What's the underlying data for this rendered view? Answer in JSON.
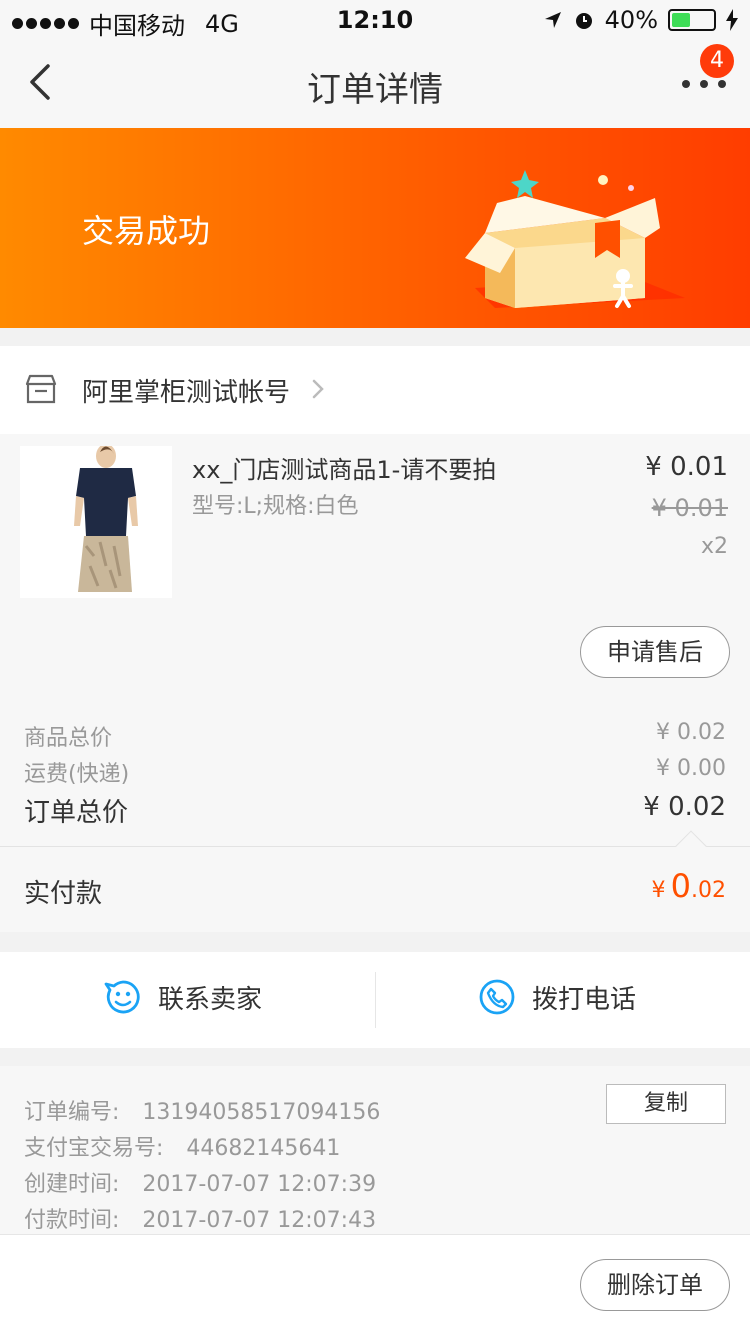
{
  "status_bar": {
    "carrier": "中国移动",
    "network": "4G",
    "time": "12:10",
    "battery": "40%"
  },
  "nav": {
    "title": "订单详情",
    "badge": "4",
    "back_icon": "chevron-left-icon",
    "more_icon": "more-dots-icon"
  },
  "banner": {
    "status": "交易成功"
  },
  "shop": {
    "name": "阿里掌柜测试帐号"
  },
  "item": {
    "title": "xx_门店测试商品1-请不要拍",
    "spec": "型号:L;规格:白色",
    "price": "¥ 0.01",
    "original_price": "¥ 0.01",
    "quantity": "x2",
    "aftersale_label": "申请售后"
  },
  "totals": {
    "goods_label": "商品总价",
    "goods_value": "¥ 0.02",
    "shipping_label": "运费(快递)",
    "shipping_value": "¥ 0.00",
    "order_label": "订单总价",
    "order_value": "¥ 0.02"
  },
  "paid": {
    "label": "实付款",
    "currency": "¥",
    "int": "0",
    "dec": ".02"
  },
  "contact": {
    "seller_label": "联系卖家",
    "call_label": "拨打电话"
  },
  "info": {
    "order_no_label": "订单编号:",
    "order_no": "13194058517094156",
    "alipay_label": "支付宝交易号:",
    "alipay_no": "44682145641",
    "created_label": "创建时间:",
    "created_time": "2017-07-07 12:07:39",
    "paid_label": "付款时间:",
    "paid_time": "2017-07-07 12:07:43",
    "copy_label": "复制"
  },
  "footer": {
    "delete_label": "删除订单"
  },
  "colors": {
    "accent": "#ff5000",
    "banner_start": "#ff8a00",
    "banner_end": "#ff3d00",
    "link_blue": "#1aa3f5"
  }
}
